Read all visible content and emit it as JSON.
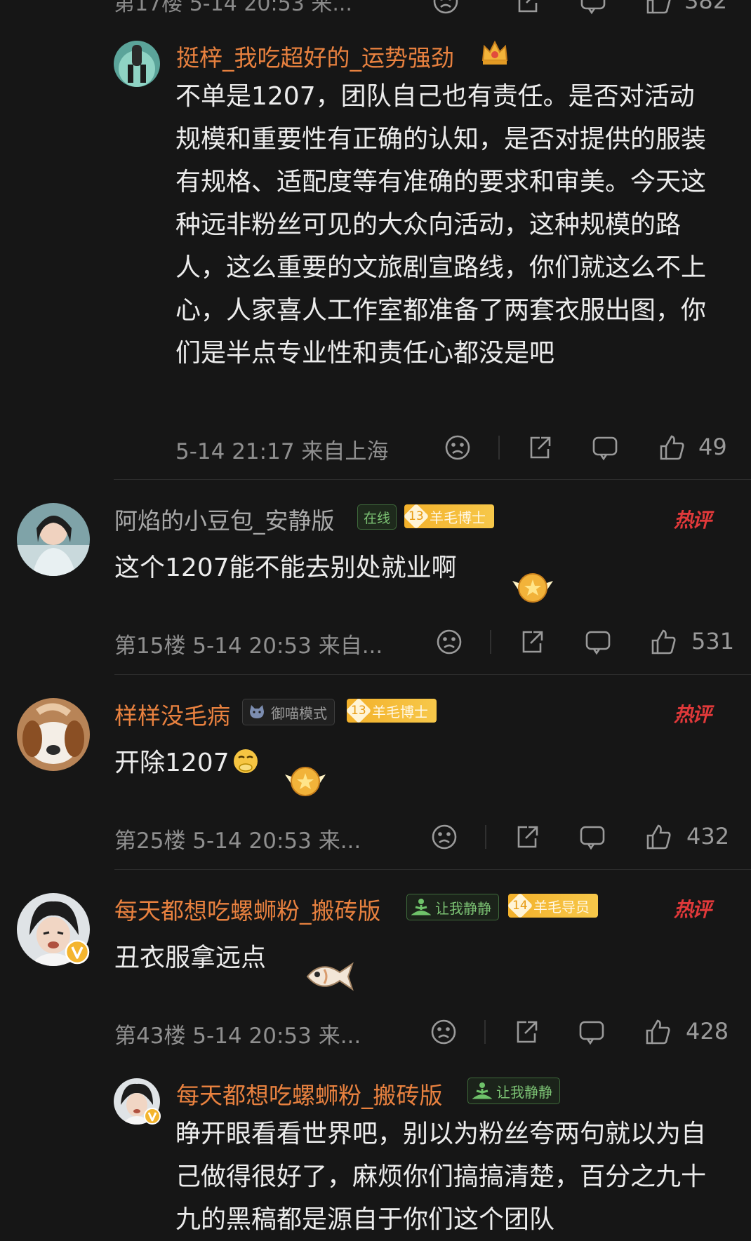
{
  "top_row_text": "第17楼 5-14 20:53 来...",
  "top_row_like": "382",
  "comments": [
    {
      "username": "挺梓_我吃超好的_运势强劲",
      "text": "不单是1207，团队自己也有责任。是否对活动规模和重要性有正确的认知，是否对提供的服装有规格、适配度等有准确的要求和审美。今天这种远非粉丝可见的大众向活动，这种规模的路人，这么重要的文旅剧宣路线，你们就这么不上心，人家喜人工作室都准备了两套衣服出图，你们是半点专业性和责任心都没是吧",
      "meta": "5-14 21:17  来自上海",
      "likes": "49"
    },
    {
      "username": "阿焰的小豆包_安静版",
      "badge_online": "在线",
      "level": "13",
      "level_title": "羊毛博士",
      "hot_label": "热评",
      "text": "这个1207能不能去别处就业啊",
      "meta": "第15楼  5-14 20:53  来自...",
      "likes": "531"
    },
    {
      "username": "样样没毛病",
      "mode_badge": "御喵模式",
      "level": "13",
      "level_title": "羊毛博士",
      "hot_label": "热评",
      "text": "开除1207",
      "meta": "第25楼  5-14 20:53  来...",
      "likes": "432"
    },
    {
      "username": "每天都想吃螺蛳粉_搬砖版",
      "mode_badge": "让我静静",
      "level": "14",
      "level_title": "羊毛导员",
      "hot_label": "热评",
      "text": "丑衣服拿远点",
      "meta": "第43楼  5-14 20:53  来...",
      "likes": "428"
    },
    {
      "username": "每天都想吃螺蛳粉_搬砖版",
      "mode_badge": "让我静静",
      "text": "睁开眼看看世界吧，别以为粉丝夸两句就以为自己做得很好了，麻烦你们搞搞清楚，百分之九十九的黑稿都是源自于你们这个团队"
    }
  ],
  "colors": {
    "background": "#161616",
    "username": "#e8813f",
    "hot": "#e0393a",
    "level_badge": "#f3b12b"
  },
  "icons": [
    "dislike-icon",
    "share-icon",
    "comment-icon",
    "like-icon",
    "crown-icon",
    "vip-v-icon"
  ]
}
